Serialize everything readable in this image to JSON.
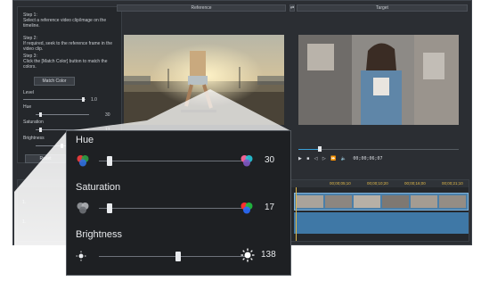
{
  "left_panel": {
    "step1": "Step 1:\nSelect a reference video clip/image on the timeline.",
    "step2": "Step 2:\nIf required, seek to the reference frame in the video clip.",
    "step3": "Step 3:\nClick the [Match Color] button to match the colors.",
    "match_color_button": "Match Color",
    "level_label": "Level",
    "level_value": "1.0",
    "hue_label": "Hue",
    "hue_value": "30",
    "saturation_label": "Saturation",
    "saturation_value": "17",
    "brightness_label": "Brightness",
    "brightness_value": "138",
    "reset_button": "Reset"
  },
  "preview": {
    "reference_label": "Reference",
    "target_label": "Target",
    "timecode": "00;00;06;07"
  },
  "timeline": {
    "ticks": [
      "00;00;05;10",
      "00;00;10;20",
      "00;00;16;00",
      "00;00;21;10"
    ],
    "track_labels": [
      "1.",
      "1."
    ]
  },
  "overlay": {
    "hue_label": "Hue",
    "hue_value": "30",
    "hue_level": 0.07,
    "saturation_label": "Saturation",
    "saturation_value": "17",
    "saturation_level": 0.07,
    "brightness_label": "Brightness",
    "brightness_value": "138",
    "brightness_level": 0.54
  },
  "colors": {
    "accent": "#3aa0d8",
    "timeline_marker": "#e0b84a"
  }
}
